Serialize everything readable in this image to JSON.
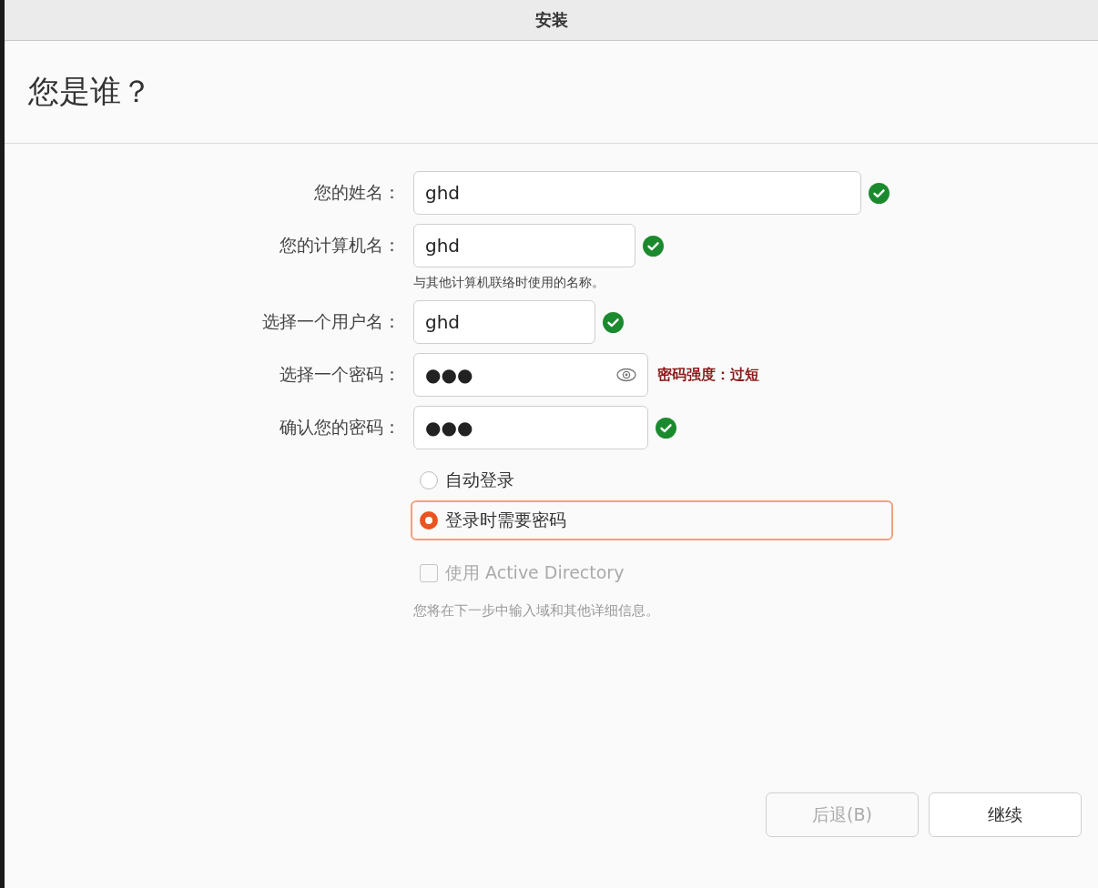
{
  "window": {
    "title": "安装"
  },
  "heading": "您是谁？",
  "fields": [
    {
      "label": "您的姓名：",
      "value": "ghd",
      "kind": "text",
      "valid": true
    },
    {
      "label": "您的计算机名：",
      "value": "ghd",
      "kind": "text",
      "valid": true,
      "hint": "与其他计算机联络时使用的名称。"
    },
    {
      "label": "选择一个用户名：",
      "value": "ghd",
      "kind": "text",
      "valid": true
    },
    {
      "label": "选择一个密码：",
      "value": "●●●",
      "kind": "password",
      "valid": false,
      "strength": "密码强度：过短"
    },
    {
      "label": "确认您的密码：",
      "value": "●●●",
      "kind": "text",
      "valid": true
    }
  ],
  "login_options": [
    {
      "label": "自动登录",
      "selected": false
    },
    {
      "label": "登录时需要密码",
      "selected": true
    }
  ],
  "active_directory": {
    "label": "使用 Active Directory",
    "checked": false,
    "disabled": true
  },
  "note": "您将在下一步中输入域和其他详细信息。",
  "buttons": [
    {
      "label": "后退(B)",
      "disabled": true
    },
    {
      "label": "继续",
      "disabled": false
    }
  ]
}
